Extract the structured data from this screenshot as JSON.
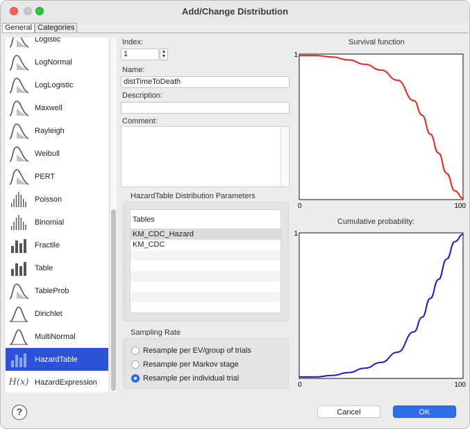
{
  "window": {
    "title": "Add/Change Distribution"
  },
  "tabs": [
    {
      "label": "General"
    },
    {
      "label": "Categories"
    }
  ],
  "distributions": [
    {
      "label": "Logistic",
      "icon": "curve-icon"
    },
    {
      "label": "LogNormal",
      "icon": "curve-icon"
    },
    {
      "label": "LogLogistic",
      "icon": "curve-icon"
    },
    {
      "label": "Maxwell",
      "icon": "curve-icon"
    },
    {
      "label": "Rayleigh",
      "icon": "curve-icon"
    },
    {
      "label": "Weibull",
      "icon": "curve-icon"
    },
    {
      "label": "PERT",
      "icon": "curve-icon"
    },
    {
      "label": "Poisson",
      "icon": "discrete-bars-icon"
    },
    {
      "label": "Binomial",
      "icon": "discrete-bars-icon"
    },
    {
      "label": "Fractile",
      "icon": "bars-icon"
    },
    {
      "label": "Table",
      "icon": "bars-icon"
    },
    {
      "label": "TableProb",
      "icon": "curve-icon"
    },
    {
      "label": "Dirichlet",
      "icon": "bell-icon"
    },
    {
      "label": "MultiNormal",
      "icon": "bell-icon"
    },
    {
      "label": "HazardTable",
      "icon": "bars-icon",
      "selected": true
    },
    {
      "label": "HazardExpression",
      "icon": "hx-icon",
      "icon_text": "H(x)"
    }
  ],
  "form": {
    "index_label": "Index:",
    "index_value": "1",
    "name_label": "Name:",
    "name_value": "distTimeToDeath",
    "description_label": "Description:",
    "description_value": "",
    "comment_label": "Comment:",
    "comment_value": ""
  },
  "params": {
    "group_title": "HazardTable Distribution Parameters",
    "tables_header": "Tables",
    "tables": [
      "KM_CDC_Hazard",
      "KM_CDC"
    ],
    "selected_table": "KM_CDC_Hazard"
  },
  "sampling": {
    "title": "Sampling Rate",
    "options": [
      {
        "label": "Resample per EV/group of trials",
        "checked": false
      },
      {
        "label": "Resample per Markov stage",
        "checked": false
      },
      {
        "label": "Resample per individual trial",
        "checked": true
      }
    ]
  },
  "buttons": {
    "cancel": "Cancel",
    "ok": "OK",
    "help": "?"
  },
  "chart_data": [
    {
      "type": "line",
      "title": "Survival function",
      "color": "#e8231f",
      "xlim": [
        0,
        100
      ],
      "ylim": [
        0,
        1
      ],
      "x_tick_labels": [
        "0",
        "100"
      ],
      "y_tick_labels": [
        "1"
      ],
      "x": [
        0,
        10,
        20,
        30,
        40,
        50,
        60,
        70,
        75,
        80,
        85,
        90,
        95,
        100
      ],
      "y": [
        0.99,
        0.99,
        0.98,
        0.96,
        0.93,
        0.89,
        0.82,
        0.68,
        0.58,
        0.45,
        0.32,
        0.18,
        0.06,
        0.01
      ]
    },
    {
      "type": "line",
      "title": "Cumulative probability:",
      "color": "#2a11c8",
      "xlim": [
        0,
        100
      ],
      "ylim": [
        0,
        1
      ],
      "x_tick_labels": [
        "0",
        "100"
      ],
      "y_tick_labels": [
        "1"
      ],
      "x": [
        0,
        10,
        20,
        30,
        40,
        50,
        60,
        70,
        75,
        80,
        85,
        90,
        95,
        100
      ],
      "y": [
        0.01,
        0.01,
        0.02,
        0.04,
        0.07,
        0.11,
        0.18,
        0.32,
        0.42,
        0.55,
        0.68,
        0.82,
        0.94,
        0.99
      ]
    }
  ]
}
